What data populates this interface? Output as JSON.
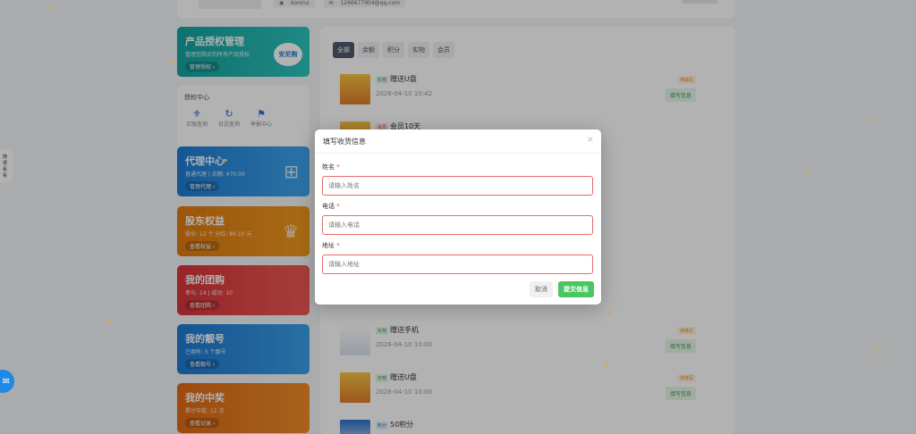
{
  "top": {
    "username": "konirui",
    "email": "1266677904@qq.com"
  },
  "sidebar": {
    "product": {
      "title": "产品授权管理",
      "sub": "管理您购买的所有产品授权",
      "btn": "管理授权 ›",
      "logo": "安尼购"
    },
    "auth_center": {
      "title": "授权中心",
      "items": [
        "正版查询",
        "日志查询",
        "举报中心"
      ]
    },
    "agent": {
      "title": "代理中心",
      "sub": "普通代理 | 余额: ¥70.00",
      "btn": "管理代理 ›"
    },
    "share": {
      "title": "股东权益",
      "sub": "股份: 12 个  分红: 86.10 元",
      "btn": "查看权益 ›"
    },
    "group": {
      "title": "我的团购",
      "sub": "参与: 14 | 成功: 10",
      "btn": "查看团购 ›"
    },
    "account": {
      "title": "我的靓号",
      "sub": "已拥有: 5 个靓号",
      "btn": "查看靓号 ›"
    },
    "prize": {
      "title": "我的中奖",
      "sub": "累计中奖: 12 次",
      "btn": "查看记录 ›"
    }
  },
  "tabs": [
    "全部",
    "余额",
    "积分",
    "实物",
    "会员"
  ],
  "rows": [
    {
      "badge": "实物",
      "title": "赠送U盘",
      "date": "2026-04-10 10:42",
      "status": "待填写",
      "action": "填写信息"
    },
    {
      "badge": "会员",
      "title": "会员10天",
      "date": "",
      "status": "",
      "action": ""
    },
    {
      "badge": "实物",
      "title": "赠送手机",
      "date": "2026-04-10 10:00",
      "status": "待填写",
      "action": "填写信息"
    },
    {
      "badge": "实物",
      "title": "赠送U盘",
      "date": "2026-04-10 10:00",
      "status": "待填写",
      "action": "填写信息"
    },
    {
      "badge": "积分",
      "title": "50积分",
      "date": "",
      "status": "",
      "action": ""
    }
  ],
  "modal": {
    "title": "填写收货信息",
    "close": "×",
    "fields": [
      {
        "label": "姓名",
        "placeholder": "请输入姓名"
      },
      {
        "label": "电话",
        "placeholder": "请输入电话"
      },
      {
        "label": "地址",
        "placeholder": "请输入地址"
      }
    ],
    "cancel": "取消",
    "submit": "提交信息"
  },
  "side_tag": "随便看看",
  "colors": {
    "accent": "#4cc45f",
    "primary": "#1e88e5"
  },
  "icons": [
    "user-icon",
    "mail-icon",
    "close-icon",
    "chat-icon",
    "shield-icon",
    "clock-icon",
    "flag-icon",
    "crown-icon",
    "network-icon"
  ]
}
